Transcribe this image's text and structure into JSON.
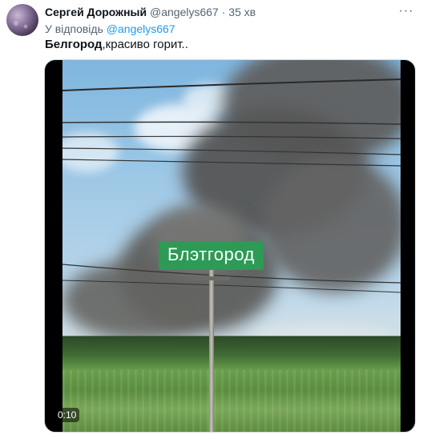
{
  "tweet": {
    "author_name": "Сергей Дорожный",
    "author_handle": "@angelys667",
    "separator": "·",
    "time_ago": "35 хв",
    "more_icon": "ellipsis-icon",
    "reply_prefix": "У відповідь",
    "reply_handle": "@angelys667",
    "text_bold": "Белгород",
    "text_rest": ",красиво горит.."
  },
  "media": {
    "overlay_text": "Блэтгород",
    "duration": "0:10"
  },
  "colors": {
    "link": "#1d9bf0",
    "secondary_text": "#536471",
    "label_green": "#2d9a55"
  }
}
